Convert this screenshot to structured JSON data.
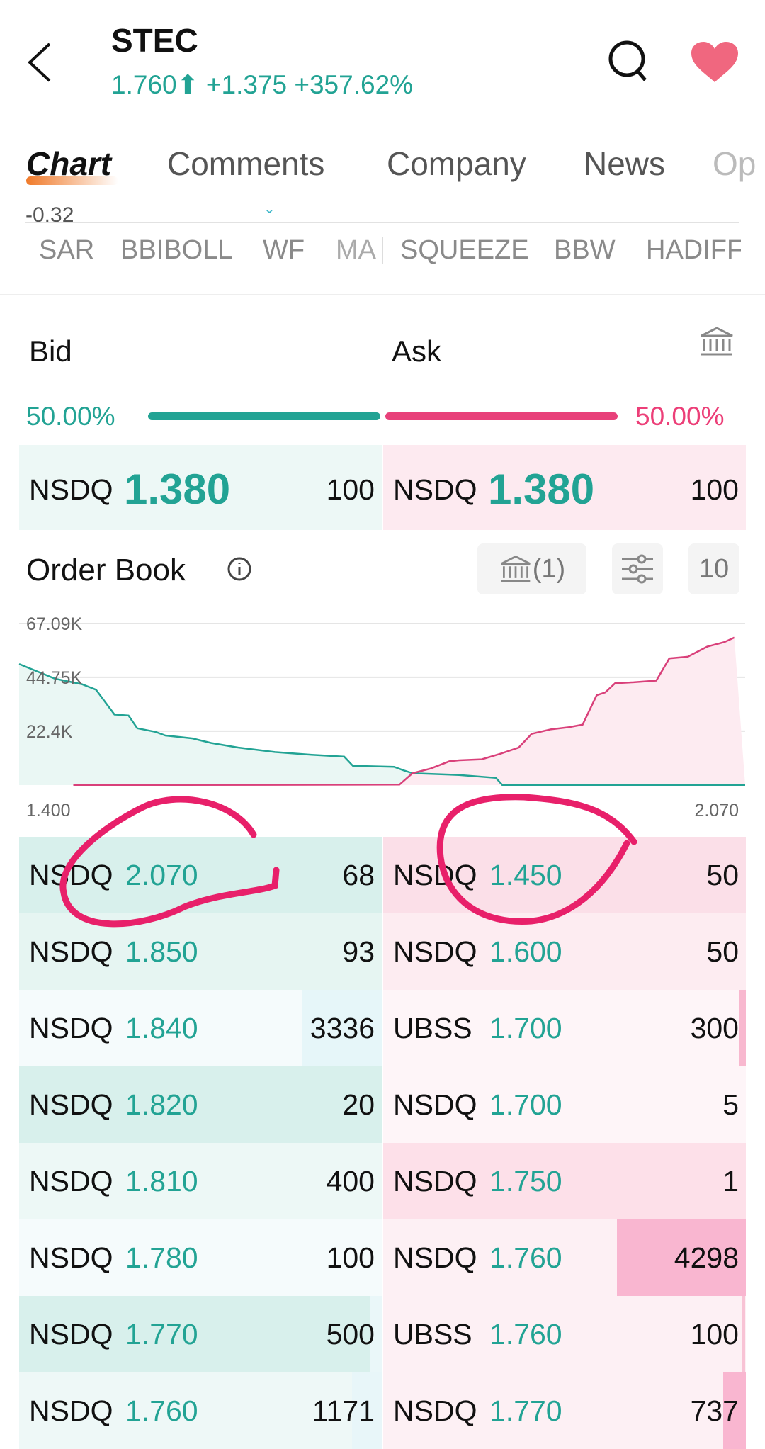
{
  "header": {
    "symbol": "STEC",
    "price": "1.760",
    "change": "+1.375",
    "change_pct": "+357.62%",
    "favorited": true
  },
  "tabs": [
    {
      "label": "Chart",
      "active": true
    },
    {
      "label": "Comments"
    },
    {
      "label": "Company"
    },
    {
      "label": "News"
    },
    {
      "label": "Op"
    }
  ],
  "indicator_strip": {
    "value_label": "-0.32",
    "items": [
      "SAR",
      "BBIBOLL",
      "WF",
      "MA",
      "SQUEEZE",
      "BBW",
      "HADIFF"
    ]
  },
  "bid_ask": {
    "bid_label": "Bid",
    "ask_label": "Ask",
    "bid_pct": "50.00%",
    "ask_pct": "50.00%",
    "best_bid": {
      "exchange": "NSDQ",
      "price": "1.380",
      "size": "100"
    },
    "best_ask": {
      "exchange": "NSDQ",
      "price": "1.380",
      "size": "100"
    }
  },
  "order_book": {
    "title": "Order Book",
    "exchange_count": "(1)",
    "levels": "10"
  },
  "colors": {
    "bid": "#22a394",
    "ask": "#e84a7f",
    "heart": "#f0677f",
    "accent": "#f07a2a"
  },
  "chart_data": {
    "type": "area",
    "y_ticks": [
      "67.09K",
      "44.75K",
      "22.4K"
    ],
    "y_tick_values": [
      67090,
      44750,
      22400
    ],
    "x_ticks": [
      "1.400",
      "2.070"
    ],
    "xlim": [
      1.4,
      2.07
    ],
    "ylim": [
      0,
      67090
    ],
    "grid": true,
    "bid": [
      [
        1.4,
        50300
      ],
      [
        1.433,
        44200
      ],
      [
        1.458,
        41900
      ],
      [
        1.471,
        39600
      ],
      [
        1.488,
        29300
      ],
      [
        1.501,
        28900
      ],
      [
        1.509,
        23600
      ],
      [
        1.526,
        22100
      ],
      [
        1.535,
        20600
      ],
      [
        1.56,
        19400
      ],
      [
        1.577,
        17500
      ],
      [
        1.602,
        15600
      ],
      [
        1.636,
        13700
      ],
      [
        1.67,
        12600
      ],
      [
        1.7,
        11800
      ],
      [
        1.708,
        8000
      ],
      [
        1.746,
        7600
      ],
      [
        1.755,
        6100
      ],
      [
        1.763,
        4900
      ],
      [
        1.806,
        4200
      ],
      [
        1.84,
        3000
      ],
      [
        1.846,
        0
      ],
      [
        2.07,
        0
      ]
    ],
    "ask": [
      [
        1.45,
        0
      ],
      [
        1.751,
        200
      ],
      [
        1.763,
        4900
      ],
      [
        1.78,
        6900
      ],
      [
        1.797,
        9900
      ],
      [
        1.806,
        10300
      ],
      [
        1.827,
        10700
      ],
      [
        1.844,
        13000
      ],
      [
        1.861,
        15600
      ],
      [
        1.873,
        21300
      ],
      [
        1.891,
        23200
      ],
      [
        1.907,
        24000
      ],
      [
        1.92,
        25100
      ],
      [
        1.933,
        37300
      ],
      [
        1.941,
        38500
      ],
      [
        1.95,
        42300
      ],
      [
        1.967,
        42700
      ],
      [
        1.988,
        43400
      ],
      [
        2.0,
        52600
      ],
      [
        2.017,
        53300
      ],
      [
        2.035,
        57500
      ],
      [
        2.051,
        59400
      ],
      [
        2.06,
        61300
      ]
    ]
  },
  "bids": [
    {
      "exchange": "NSDQ",
      "price": "2.070",
      "size": "68"
    },
    {
      "exchange": "NSDQ",
      "price": "1.850",
      "size": "93"
    },
    {
      "exchange": "NSDQ",
      "price": "1.840",
      "size": "3336"
    },
    {
      "exchange": "NSDQ",
      "price": "1.820",
      "size": "20"
    },
    {
      "exchange": "NSDQ",
      "price": "1.810",
      "size": "400"
    },
    {
      "exchange": "NSDQ",
      "price": "1.780",
      "size": "100"
    },
    {
      "exchange": "NSDQ",
      "price": "1.770",
      "size": "500"
    },
    {
      "exchange": "NSDQ",
      "price": "1.760",
      "size": "1171"
    }
  ],
  "asks": [
    {
      "exchange": "NSDQ",
      "price": "1.450",
      "size": "50"
    },
    {
      "exchange": "NSDQ",
      "price": "1.600",
      "size": "50"
    },
    {
      "exchange": "UBSS",
      "price": "1.700",
      "size": "300"
    },
    {
      "exchange": "NSDQ",
      "price": "1.700",
      "size": "5"
    },
    {
      "exchange": "NSDQ",
      "price": "1.750",
      "size": "1"
    },
    {
      "exchange": "NSDQ",
      "price": "1.760",
      "size": "4298"
    },
    {
      "exchange": "UBSS",
      "price": "1.760",
      "size": "100"
    },
    {
      "exchange": "NSDQ",
      "price": "1.770",
      "size": "737"
    }
  ]
}
